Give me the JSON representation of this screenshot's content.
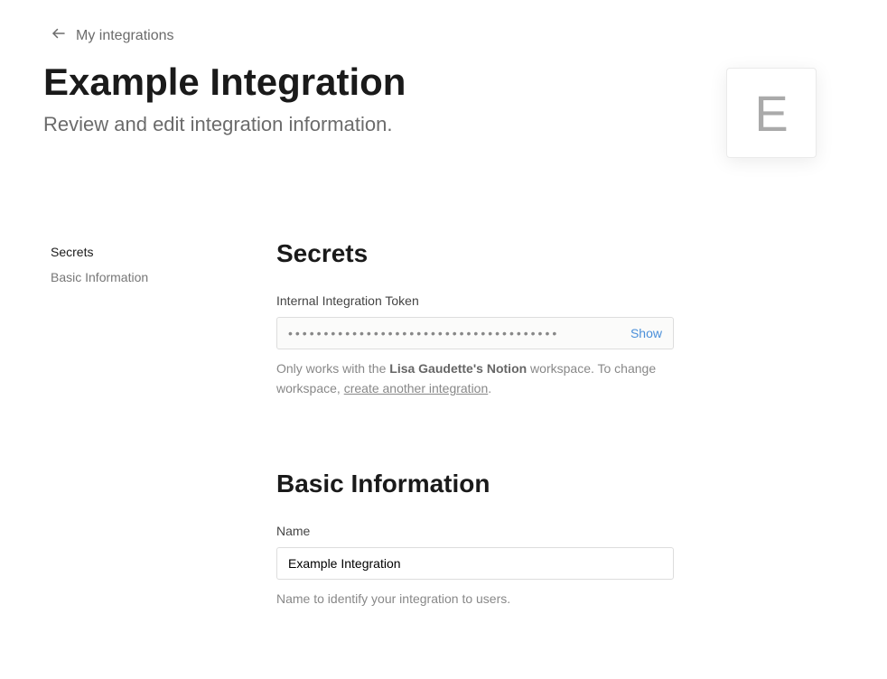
{
  "breadcrumb": {
    "back_label": "My integrations"
  },
  "header": {
    "title": "Example Integration",
    "subtitle": "Review and edit integration information.",
    "avatar_letter": "E"
  },
  "sidebar": {
    "items": [
      {
        "label": "Secrets",
        "active": true
      },
      {
        "label": "Basic Information",
        "active": false
      }
    ]
  },
  "secrets": {
    "section_title": "Secrets",
    "token_label": "Internal Integration Token",
    "token_masked": "••••••••••••••••••••••••••••••••••••••",
    "show_label": "Show",
    "help_prefix": "Only works with the ",
    "help_workspace": "Lisa Gaudette's Notion",
    "help_mid": " workspace. To change workspace, ",
    "help_link": "create another integration",
    "help_suffix": "."
  },
  "basic_info": {
    "section_title": "Basic Information",
    "name_label": "Name",
    "name_value": "Example Integration",
    "name_help": "Name to identify your integration to users."
  }
}
